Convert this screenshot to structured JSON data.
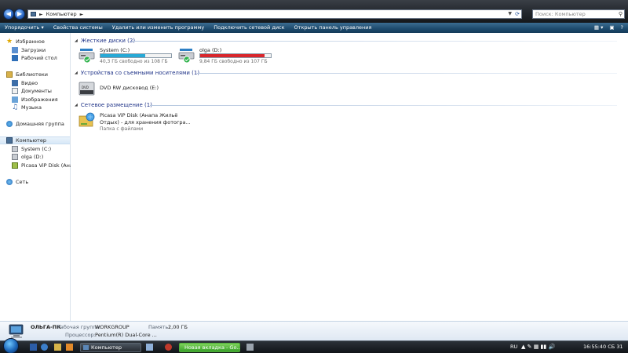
{
  "address": {
    "path": "Компьютер"
  },
  "search": {
    "placeholder": "Поиск: Компьютер"
  },
  "toolbar": {
    "organize": "Упорядочить",
    "system_props": "Свойства системы",
    "uninstall": "Удалить или изменить программу",
    "map_drive": "Подключить сетевой диск",
    "control_panel": "Открыть панель управления"
  },
  "sidebar": {
    "favorites": "Избранное",
    "downloads": "Загрузки",
    "desktop": "Рабочий стол",
    "libraries": "Библиотеки",
    "video": "Видео",
    "documents": "Документы",
    "images": "Изображения",
    "music": "Музыка",
    "homegroup": "Домашняя группа",
    "computer": "Компьютер",
    "system_c": "System (C:)",
    "olga_d": "olga (D:)",
    "picasa": "Picasa ViP Disk (Анапа Ж",
    "network": "Сеть"
  },
  "groups": {
    "hdd": "Жесткие диски (2)",
    "removable": "Устройства со съемными носителями (1)",
    "network": "Сетевое размещение (1)"
  },
  "drives": {
    "c": {
      "name": "System (C:)",
      "free": "40,3 ГБ свободно из 108 ГБ",
      "used_fraction": 0.63,
      "color": "#27a9d6"
    },
    "d": {
      "name": "olga (D:)",
      "free": "9,84 ГБ свободно из 107 ГБ",
      "used_fraction": 0.91,
      "color": "#d9262c"
    }
  },
  "removable": {
    "dvd": "DVD RW дисковод (E:)"
  },
  "network_items": {
    "picasa_line1": "Picasa ViP Disk (Анапа Жильё",
    "picasa_line2": "Отдых) - для хранения фотогра...",
    "picasa_type": "Папка с файлами"
  },
  "details": {
    "pc_name": "ОЛЬГА-ПК",
    "workgroup_label": "Рабочая группа:",
    "workgroup_value": "WORKGROUP",
    "memory_label": "Память:",
    "memory_value": "2,00 ГБ",
    "cpu_label": "Процессор:",
    "cpu_value": "Pentium(R) Dual-Core ..."
  },
  "taskbar": {
    "explorer": "Компьютер",
    "chrome": "Новая вкладка - Go...",
    "lang": "RU",
    "clock": "16:55:40 СБ 31"
  }
}
